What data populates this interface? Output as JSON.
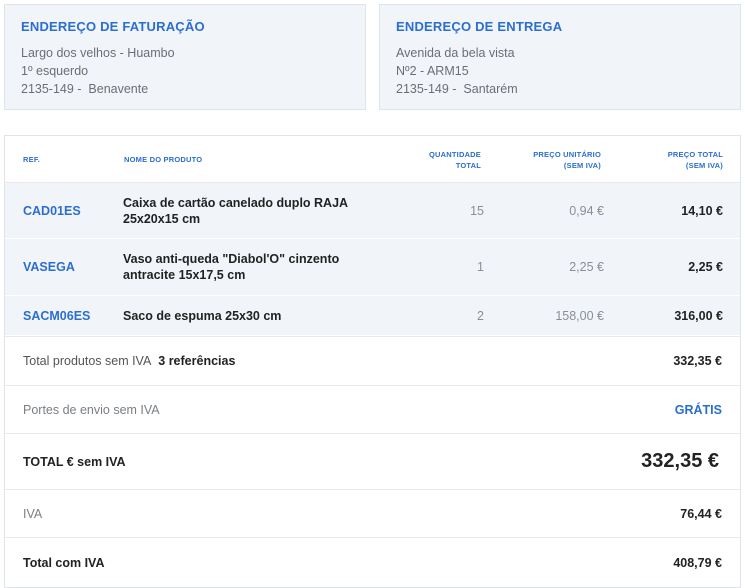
{
  "billing": {
    "title": "ENDEREÇO DE FATURAÇÃO",
    "lines": [
      "Largo dos velhos - Huambo",
      "1º esquerdo",
      "2135-149 -  Benavente"
    ]
  },
  "shipping": {
    "title": "ENDEREÇO DE ENTREGA",
    "lines": [
      "Avenida da bela vista",
      "Nº2 - ARM15",
      "2135-149 -  Santarém"
    ]
  },
  "table": {
    "headers": {
      "ref": "REF.",
      "name": "NOME DO PRODUTO",
      "qty_1": "QUANTIDADE",
      "qty_2": "TOTAL",
      "unit_1": "PREÇO UNITÁRIO",
      "unit_2": "(SEM IVA)",
      "total_1": "PREÇO TOTAL",
      "total_2": "(SEM IVA)"
    },
    "rows": [
      {
        "ref": "CAD01ES",
        "name": "Caixa de cartão canelado duplo RAJA 25x20x15 cm",
        "qty": "15",
        "unit": "0,94 €",
        "total": "14,10 €"
      },
      {
        "ref": "VASEGA",
        "name": "Vaso anti-queda \"Diabol'O\" cinzento antracite 15x17,5 cm",
        "qty": "1",
        "unit": "2,25 €",
        "total": "2,25 €"
      },
      {
        "ref": "SACM06ES",
        "name": "Saco de espuma 25x30 cm",
        "qty": "2",
        "unit": "158,00 €",
        "total": "316,00 €"
      }
    ]
  },
  "summary": {
    "products_label": "Total produtos sem IVA",
    "products_refs": "3 referências",
    "products_value": "332,35 €",
    "shipping_label": "Portes de envio sem IVA",
    "shipping_value": "GRÁTIS",
    "total_ex_label": "TOTAL € sem IVA",
    "total_ex_value": "332,35 €",
    "vat_label": "IVA",
    "vat_value": "76,44 €",
    "total_inc_label": "Total com IVA",
    "total_inc_value": "408,79 €"
  },
  "colors": {
    "accent": "#2b6ed1",
    "row_bg": "#f1f5fa",
    "highlight": "#fbe28a"
  }
}
